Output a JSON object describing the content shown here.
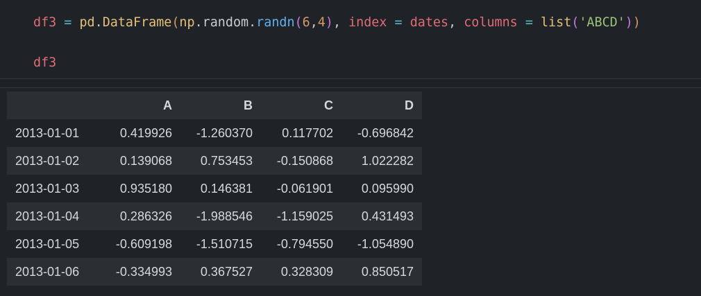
{
  "code_cell": {
    "lines": [
      {
        "tokens": [
          {
            "text": "df3",
            "cls": "tok-var"
          },
          {
            "text": " ",
            "cls": "tok-punc"
          },
          {
            "text": "=",
            "cls": "tok-op"
          },
          {
            "text": " ",
            "cls": "tok-punc"
          },
          {
            "text": "pd",
            "cls": "tok-cls"
          },
          {
            "text": ".",
            "cls": "tok-punc"
          },
          {
            "text": "DataFrame",
            "cls": "tok-cls"
          },
          {
            "text": "(",
            "cls": "tok-paren"
          },
          {
            "text": "np",
            "cls": "tok-cls"
          },
          {
            "text": ".",
            "cls": "tok-punc"
          },
          {
            "text": "random",
            "cls": "tok-punc"
          },
          {
            "text": ".",
            "cls": "tok-punc"
          },
          {
            "text": "randn",
            "cls": "tok-fn"
          },
          {
            "text": "(",
            "cls": "tok-paren2"
          },
          {
            "text": "6",
            "cls": "tok-num"
          },
          {
            "text": ",",
            "cls": "tok-punc"
          },
          {
            "text": "4",
            "cls": "tok-num"
          },
          {
            "text": ")",
            "cls": "tok-paren2"
          },
          {
            "text": ", ",
            "cls": "tok-punc"
          },
          {
            "text": "index",
            "cls": "tok-kw"
          },
          {
            "text": " ",
            "cls": "tok-punc"
          },
          {
            "text": "=",
            "cls": "tok-op"
          },
          {
            "text": " ",
            "cls": "tok-punc"
          },
          {
            "text": "dates",
            "cls": "tok-var"
          },
          {
            "text": ", ",
            "cls": "tok-punc"
          },
          {
            "text": "columns",
            "cls": "tok-kw"
          },
          {
            "text": " ",
            "cls": "tok-punc"
          },
          {
            "text": "=",
            "cls": "tok-op"
          },
          {
            "text": " ",
            "cls": "tok-punc"
          },
          {
            "text": "list",
            "cls": "tok-builtin"
          },
          {
            "text": "(",
            "cls": "tok-paren2"
          },
          {
            "text": "'ABCD'",
            "cls": "tok-str"
          },
          {
            "text": ")",
            "cls": "tok-paren2"
          },
          {
            "text": ")",
            "cls": "tok-paren"
          }
        ]
      },
      {
        "tokens": [
          {
            "text": "df3",
            "cls": "tok-var"
          }
        ]
      }
    ]
  },
  "output": {
    "columns": [
      "A",
      "B",
      "C",
      "D"
    ],
    "rows": [
      {
        "label": "2013-01-01",
        "values": [
          "0.419926",
          "-1.260370",
          "0.117702",
          "-0.696842"
        ]
      },
      {
        "label": "2013-01-02",
        "values": [
          "0.139068",
          "0.753453",
          "-0.150868",
          "1.022282"
        ]
      },
      {
        "label": "2013-01-03",
        "values": [
          "0.935180",
          "0.146381",
          "-0.061901",
          "0.095990"
        ]
      },
      {
        "label": "2013-01-04",
        "values": [
          "0.286326",
          "-1.988546",
          "-1.159025",
          "0.431493"
        ]
      },
      {
        "label": "2013-01-05",
        "values": [
          "-0.609198",
          "-1.510715",
          "-0.794550",
          "-1.054890"
        ]
      },
      {
        "label": "2013-01-06",
        "values": [
          "-0.334993",
          "0.367527",
          "0.328309",
          "0.850517"
        ]
      }
    ]
  }
}
